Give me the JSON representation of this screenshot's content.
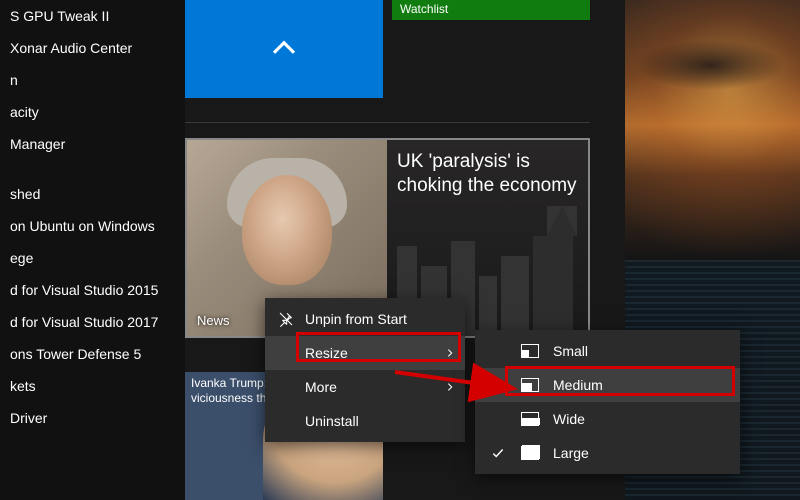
{
  "app_list": {
    "items": [
      "S GPU Tweak II",
      "Xonar Audio Center",
      "n",
      "acity",
      "Manager",
      "shed",
      "on Ubuntu on Windows",
      "ege",
      "d for Visual Studio 2015",
      "d for Visual Studio 2017",
      "ons Tower Defense 5",
      "kets",
      "Driver"
    ]
  },
  "tiles": {
    "watchlist_label": "Watchlist",
    "news": {
      "app_label": "News",
      "headline": "UK 'paralysis' is choking the economy"
    },
    "story2": {
      "line1": "Ivanka Trump:",
      "line2_partial": "viciousness tha"
    }
  },
  "context_menu": {
    "unpin": "Unpin from Start",
    "resize": "Resize",
    "more": "More",
    "uninstall": "Uninstall"
  },
  "resize_submenu": {
    "small": "Small",
    "medium": "Medium",
    "wide": "Wide",
    "large": "Large",
    "current": "Large"
  }
}
